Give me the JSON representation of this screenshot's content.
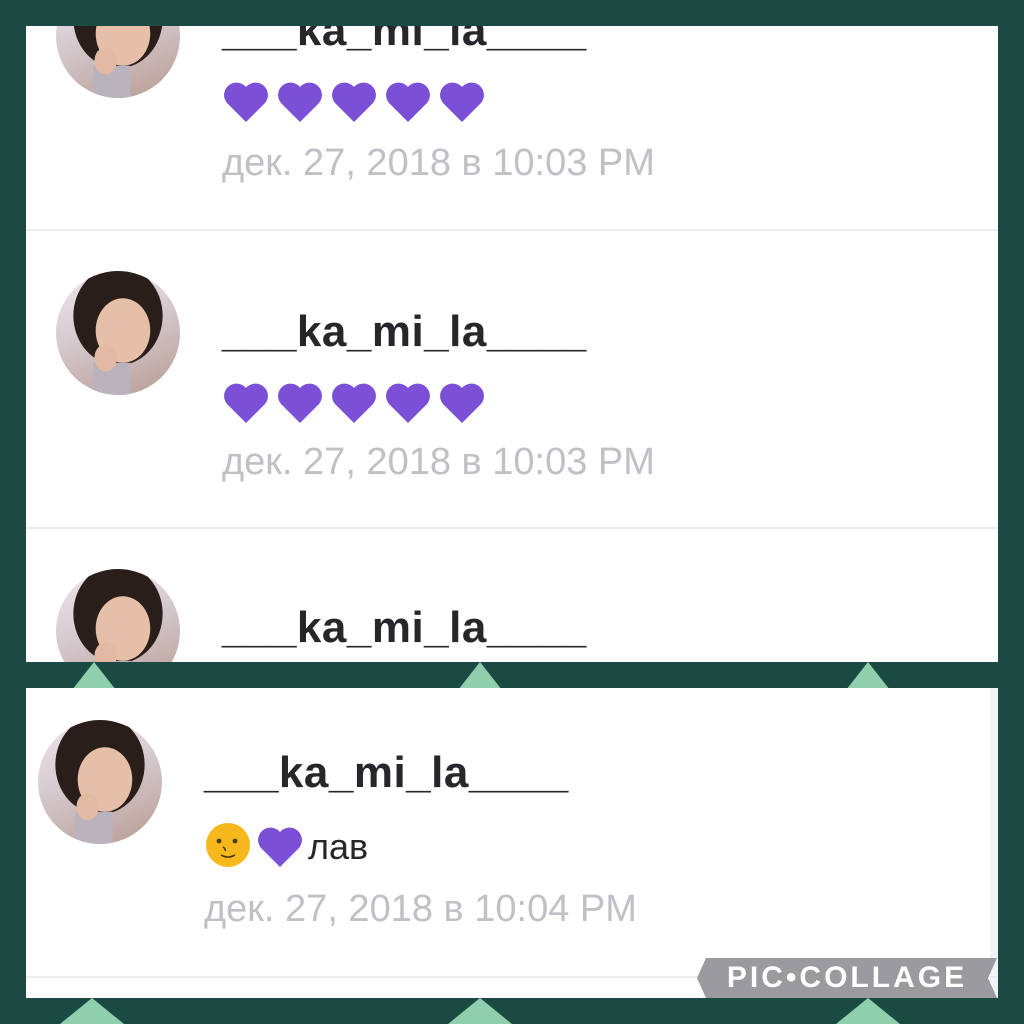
{
  "comments": [
    {
      "username": "___ka_mi_la____",
      "hearts": 5,
      "timestamp": "дек. 27, 2018 в 10:03 PM"
    },
    {
      "username": "___ka_mi_la____",
      "hearts": 5,
      "timestamp": "дек. 27, 2018 в 10:03 PM"
    },
    {
      "username": "___ka_mi_la____"
    },
    {
      "username": "___ka_mi_la____",
      "message_text": "лав",
      "timestamp": "дек. 27, 2018 в 10:04 PM"
    }
  ],
  "watermark": "PIC•COLLAGE",
  "colors": {
    "background": "#1b4a42",
    "heart": "#7b4fd6",
    "triangle": "#8fcfae",
    "timestamp": "#c0c0c6",
    "username": "#26262b"
  },
  "icons": [
    "purple-heart-icon",
    "moon-face-emoji-icon"
  ]
}
